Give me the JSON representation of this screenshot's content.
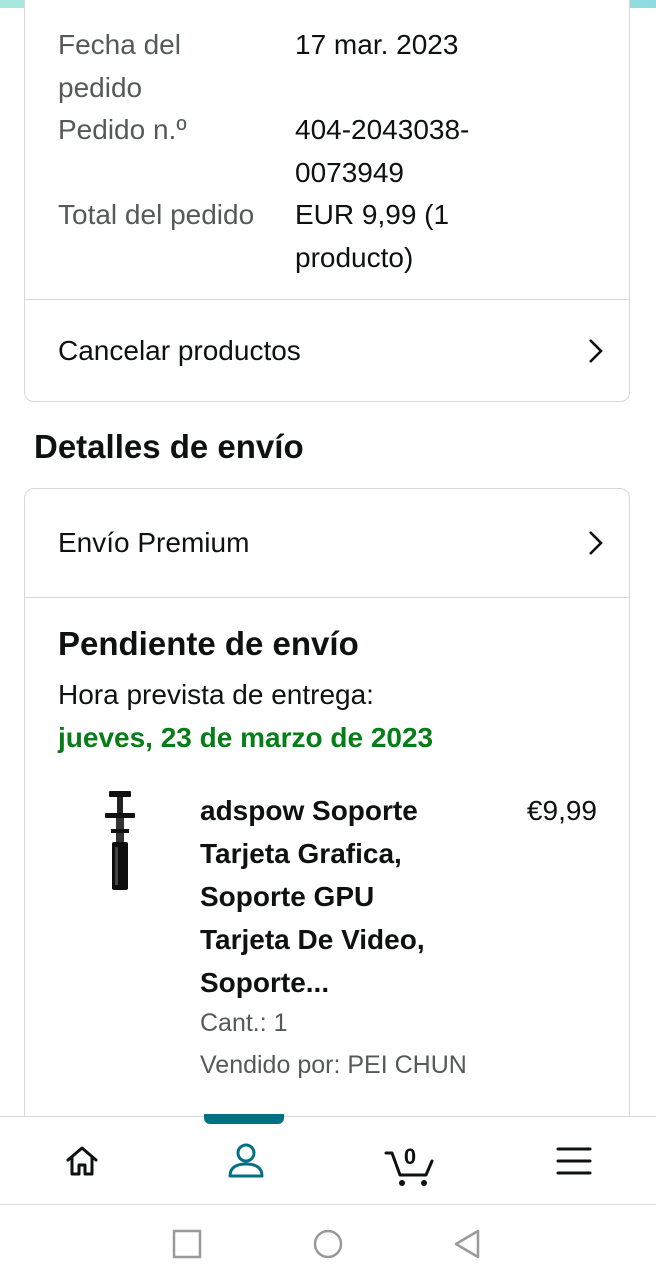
{
  "order_summary": {
    "rows": [
      {
        "label": "Fecha del pedido",
        "value": "17 mar. 2023"
      },
      {
        "label": "Pedido n.º",
        "value": "404-2043038-0073949"
      },
      {
        "label": "Total del pedido",
        "value": "EUR 9,99 (1 producto)"
      }
    ],
    "cancel_label": "Cancelar productos"
  },
  "shipping": {
    "section_title": "Detalles de envío",
    "method_label": "Envío Premium",
    "status_title": "Pendiente de envío",
    "eta_label": "Hora prevista de entrega:",
    "eta_date": "jueves, 23 de marzo de 2023",
    "eta_color": "#067d17",
    "product": {
      "title": "adspow Soporte Tarjeta Grafica, Soporte GPU Tarjeta De Video, Soporte...",
      "price": "€9,99",
      "quantity": "Cant.: 1",
      "seller": "Vendido por: PEI CHUN"
    }
  },
  "bottom_nav": {
    "items": [
      "home-icon",
      "account-icon",
      "cart-icon",
      "menu-icon"
    ],
    "cart_count": "0",
    "active": "account",
    "accent_color": "#007185"
  },
  "system_nav": [
    "recents-button",
    "home-button",
    "back-button"
  ]
}
